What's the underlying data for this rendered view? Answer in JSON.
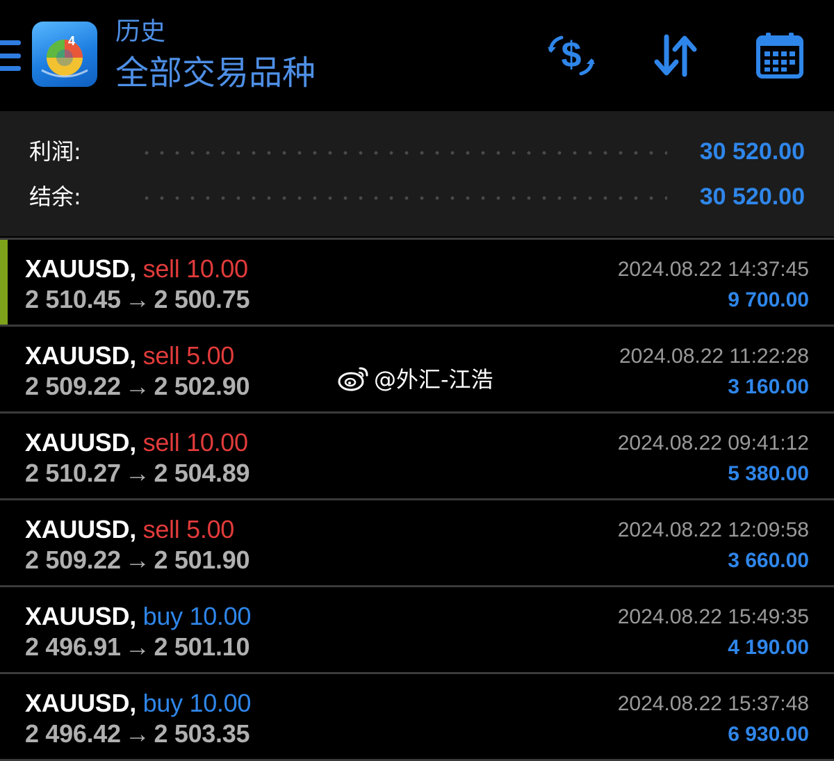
{
  "header": {
    "subtitle": "历史",
    "title": "全部交易品种",
    "icons": {
      "menu": "hamburger-menu-icon",
      "logo": "metatrader-4-logo",
      "currency": "currency-exchange-icon",
      "sort": "sort-arrows-icon",
      "calendar": "calendar-icon"
    }
  },
  "summary": {
    "profit_label": "利润:",
    "profit_value": "30 520.00",
    "balance_label": "结余:",
    "balance_value": "30 520.00"
  },
  "deals": [
    {
      "symbol": "XAUUSD,",
      "type": "sell",
      "volume": "10.00",
      "open_price": "2 510.45",
      "close_price": "2 500.75",
      "time": "2024.08.22 14:37:45",
      "profit": "9 700.00",
      "highlighted": true
    },
    {
      "symbol": "XAUUSD,",
      "type": "sell",
      "volume": "5.00",
      "open_price": "2 509.22",
      "close_price": "2 502.90",
      "time": "2024.08.22 11:22:28",
      "profit": "3 160.00",
      "highlighted": false
    },
    {
      "symbol": "XAUUSD,",
      "type": "sell",
      "volume": "10.00",
      "open_price": "2 510.27",
      "close_price": "2 504.89",
      "time": "2024.08.22 09:41:12",
      "profit": "5 380.00",
      "highlighted": false
    },
    {
      "symbol": "XAUUSD,",
      "type": "sell",
      "volume": "5.00",
      "open_price": "2 509.22",
      "close_price": "2 501.90",
      "time": "2024.08.22 12:09:58",
      "profit": "3 660.00",
      "highlighted": false
    },
    {
      "symbol": "XAUUSD,",
      "type": "buy",
      "volume": "10.00",
      "open_price": "2 496.91",
      "close_price": "2 501.10",
      "time": "2024.08.22 15:49:35",
      "profit": "4 190.00",
      "highlighted": false
    },
    {
      "symbol": "XAUUSD,",
      "type": "buy",
      "volume": "10.00",
      "open_price": "2 496.42",
      "close_price": "2 503.35",
      "time": "2024.08.22 15:37:48",
      "profit": "6 930.00",
      "highlighted": false
    }
  ],
  "watermark": {
    "text": "@外汇-江浩",
    "icon": "weibo-icon"
  },
  "colors": {
    "accent_blue": "#2f86ea",
    "sell_red": "#e23b3b",
    "highlight_green": "#7ea31b",
    "background": "#000000",
    "summary_bg": "#1c1c1c"
  }
}
